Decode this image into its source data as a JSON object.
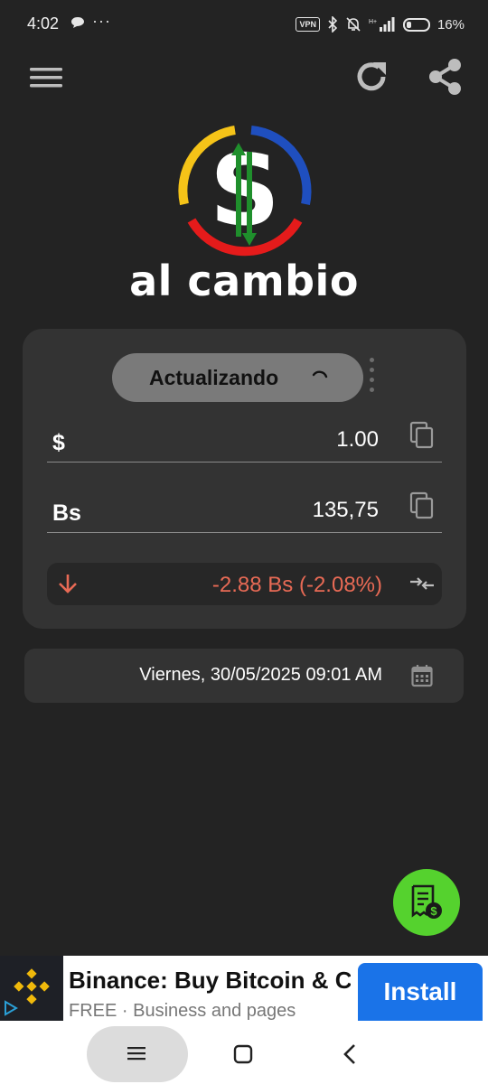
{
  "status_bar": {
    "time": "4:02",
    "dots": "···",
    "vpn_label": "VPN",
    "battery_text": "16%"
  },
  "app": {
    "brand": "al cambio",
    "colors": {
      "background": "#232323",
      "card": "#333333",
      "accent_green": "#55d22e",
      "change_red": "#e86a55",
      "logo_yellow": "#f5c318",
      "logo_blue": "#1f4fbf",
      "logo_red": "#e51b1b"
    }
  },
  "toolbar": {
    "menu_icon": "hamburger-menu-icon",
    "refresh_icon": "refresh-icon",
    "share_icon": "share-icon"
  },
  "converter": {
    "status_label": "Actualizando",
    "usd_symbol": "$",
    "usd_value": "1.00",
    "bs_symbol": "Bs",
    "bs_value": "135,75",
    "change_text": "-2.88 Bs (-2.08%)"
  },
  "date": {
    "text": "Viernes, 30/05/2025 09:01 AM"
  },
  "ad": {
    "title": "Binance: Buy Bitcoin & Crypto",
    "subtitle": "FREE · Business and pages",
    "install_label": "Install"
  }
}
